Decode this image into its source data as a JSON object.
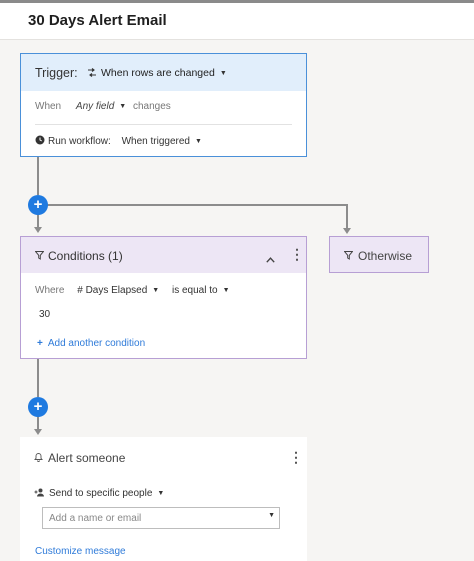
{
  "page": {
    "title": "30 Days Alert Email"
  },
  "trigger": {
    "label": "Trigger:",
    "event": "When rows are changed",
    "when_label": "When",
    "field_value": "Any field",
    "changes_label": "changes",
    "run_label": "Run workflow:",
    "run_value": "When triggered"
  },
  "conditions": {
    "title": "Conditions (1)",
    "where_label": "Where",
    "field": "# Days Elapsed",
    "operator": "is equal to",
    "value": "30",
    "add_label": "Add another condition"
  },
  "otherwise": {
    "label": "Otherwise"
  },
  "alert": {
    "title": "Alert someone",
    "send_label": "Send to specific people",
    "input_placeholder": "Add a name or email",
    "customize_label": "Customize message"
  },
  "icons": {
    "trigger_event": "refresh-rows-icon",
    "run_workflow": "clock-icon",
    "filter": "filter-icon",
    "bell": "bell-icon",
    "add_person": "add-person-icon"
  },
  "colors": {
    "accent": "#1f7ae0",
    "trigger_border": "#4a90d9",
    "trigger_header": "#e1eefb",
    "condition_border": "#b79fd4",
    "condition_header": "#ede6f5",
    "link": "#2f7bd9"
  }
}
